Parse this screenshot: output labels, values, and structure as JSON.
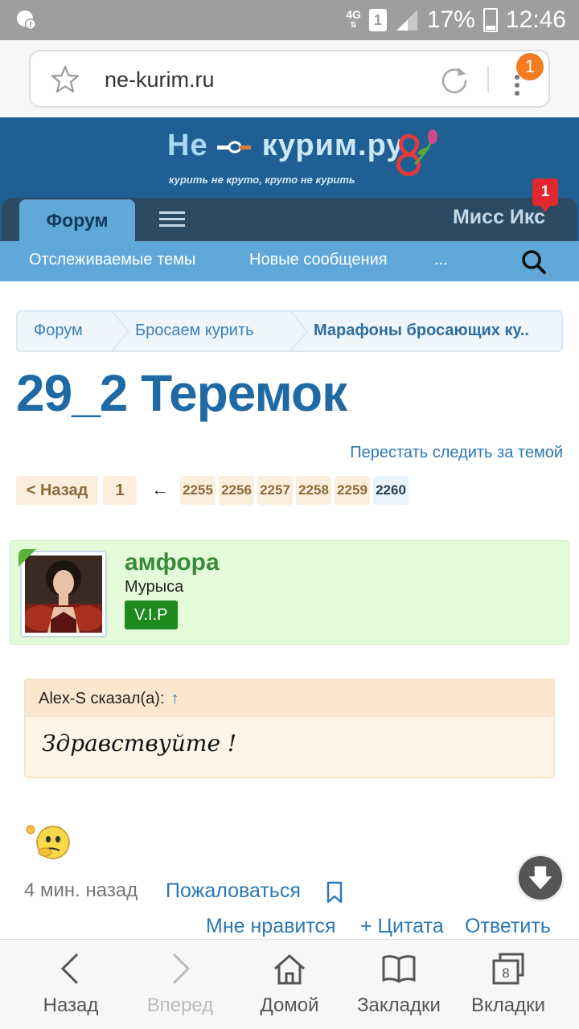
{
  "status_bar": {
    "network": "4G",
    "sim": "1",
    "battery": "17%",
    "time": "12:46"
  },
  "browser": {
    "url": "ne-kurim.ru",
    "menu_badge": "1"
  },
  "site": {
    "logo_main_1": "Не",
    "logo_main_2": "курим.ру",
    "logo_tagline": "курить не круто, круто не курить"
  },
  "nav": {
    "forum_tab": "Форум",
    "user_name": "Мисс Икс",
    "user_badge": "1",
    "sub_watched": "Отслеживаемые темы",
    "sub_new": "Новые сообщения",
    "sub_more": "..."
  },
  "breadcrumb": [
    "Форум",
    "Бросаем курить",
    "Марафоны бросающих ку.."
  ],
  "page_title": "29_2 Теремок",
  "unwatch_label": "Перестать следить за темой",
  "pagination": {
    "back": "< Назад",
    "first": "1",
    "ellipsis_arrow": "←",
    "pages": [
      "2255",
      "2256",
      "2257",
      "2258",
      "2259",
      "2260"
    ],
    "current": "2260"
  },
  "post": {
    "author_name": "амфора",
    "author_title": "Мурыса",
    "author_badge": "V.I.P",
    "quote_author": "Alex-S сказал(а):",
    "quote_jump": "↑",
    "quote_text": "Здравствуйте !",
    "time": "4 мин. назад",
    "report": "Пожаловаться",
    "like": "Мне нравится",
    "quote": "+ Цитата",
    "reply": "Ответить"
  },
  "bottom_bar": {
    "back": "Назад",
    "forward": "Вперед",
    "home": "Домой",
    "bookmarks": "Закладки",
    "tabs": "Вкладки",
    "tabs_count": "8"
  },
  "colors": {
    "header_bg": "#1f5f93",
    "nav_light": "#5fa8d8",
    "link": "#2a79b5",
    "author_bg": "#e4fbd9",
    "vip_badge": "#1e8a1e"
  }
}
